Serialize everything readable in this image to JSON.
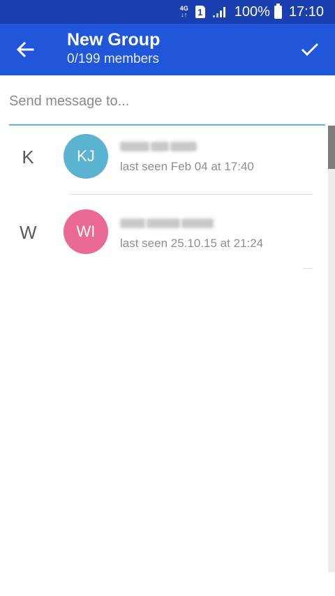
{
  "status_bar": {
    "network_top": "4G",
    "network_bottom": "↓↑",
    "sim_slot": "1",
    "battery": "100%",
    "time": "17:10"
  },
  "header": {
    "title": "New Group",
    "subtitle": "0/199 members",
    "back_icon": "arrow-left-icon",
    "confirm_icon": "check-icon"
  },
  "search": {
    "placeholder": "Send message to...",
    "value": ""
  },
  "contacts": [
    {
      "section": "K",
      "initials": "KJ",
      "avatar_color": "#5bb3d2",
      "status": "last seen Feb 04 at 17:40"
    },
    {
      "section": "W",
      "initials": "WI",
      "avatar_color": "#eb6a93",
      "status": "last seen 25.10.15 at 21:24"
    }
  ],
  "colors": {
    "status_bar": "#1a3fb0",
    "app_bar": "#2056d9",
    "search_underline": "#5fb3d6"
  }
}
